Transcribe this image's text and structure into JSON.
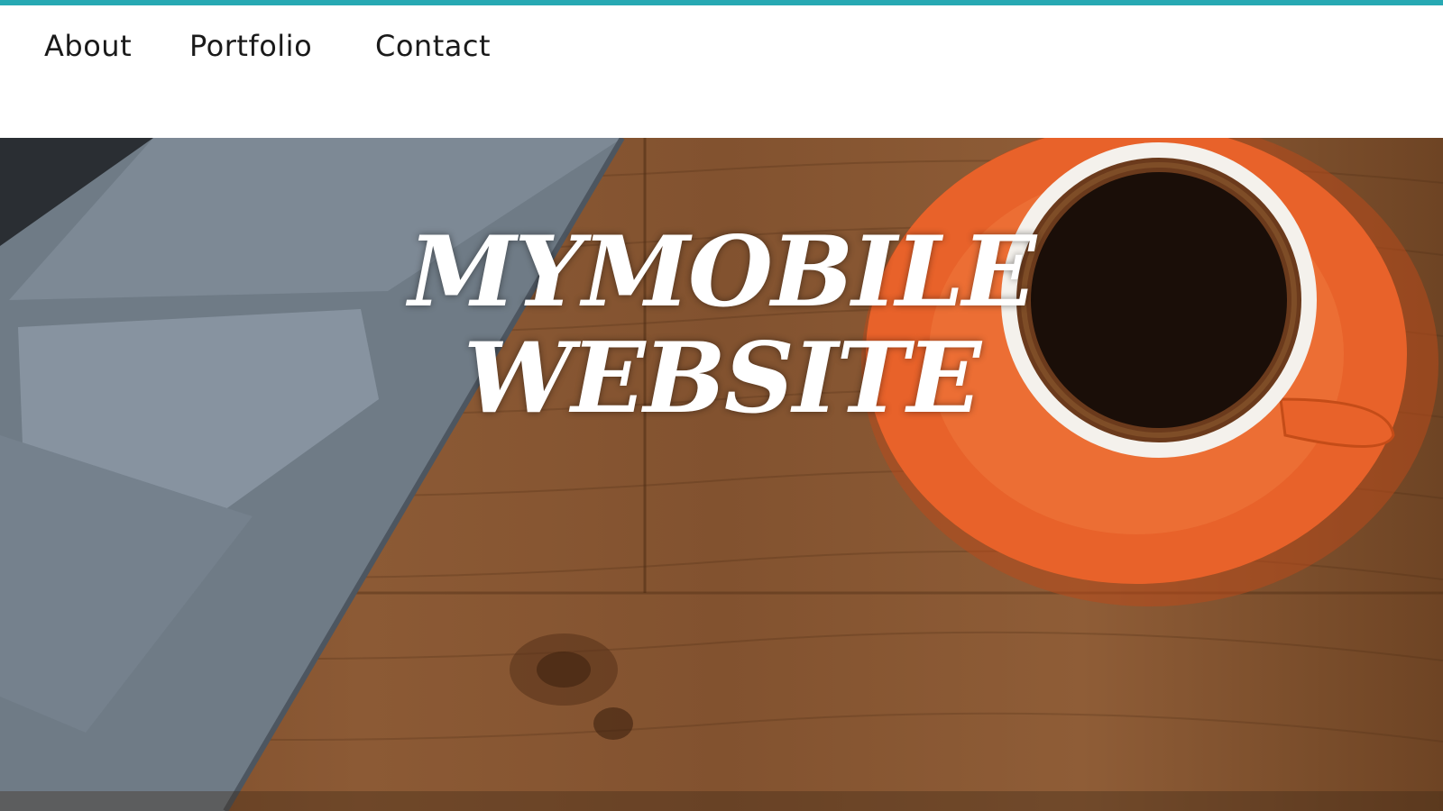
{
  "nav": {
    "items": [
      {
        "label": "About"
      },
      {
        "label": "Portfolio"
      },
      {
        "label": "Contact"
      }
    ]
  },
  "hero": {
    "title_line1": "MYMOBILE",
    "title_line2": "WEBSITE",
    "background": "laptop and coffee cup on wooden desk"
  },
  "colors": {
    "accent": "#27a9b3",
    "wood": "#8c5a35",
    "saucer": "#e8622a",
    "laptop": "#6f7b86",
    "text_white": "#ffffff"
  }
}
